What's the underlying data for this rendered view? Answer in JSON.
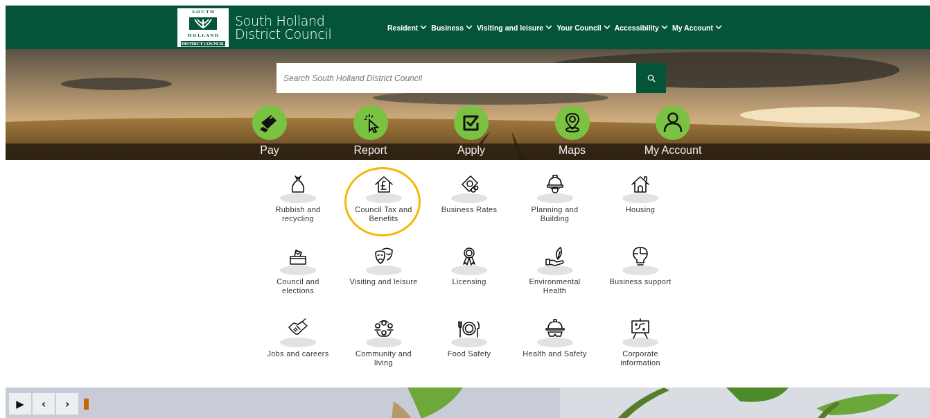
{
  "header": {
    "logo": {
      "top": "S O U T H",
      "middle": "H O L L A N D",
      "bottom": "DISTRICT COUNCIL"
    },
    "title": "South Holland District Council",
    "nav": [
      {
        "label": "Resident"
      },
      {
        "label": "Business"
      },
      {
        "label": "Visiting and leisure"
      },
      {
        "label": "Your Council"
      },
      {
        "label": "Accessibility"
      },
      {
        "label": "My Account"
      }
    ]
  },
  "search": {
    "placeholder": "Search South Holland District Council"
  },
  "quick_links": [
    {
      "label": "Pay"
    },
    {
      "label": "Report"
    },
    {
      "label": "Apply"
    },
    {
      "label": "Maps"
    },
    {
      "label": "My Account"
    }
  ],
  "tiles": [
    {
      "label": "Rubbish and recycling",
      "highlighted": false
    },
    {
      "label": "Council Tax and Benefits",
      "highlighted": true
    },
    {
      "label": "Business Rates",
      "highlighted": false
    },
    {
      "label": "Planning and Building",
      "highlighted": false
    },
    {
      "label": "Housing",
      "highlighted": false
    },
    {
      "label": "Council and elections",
      "highlighted": false
    },
    {
      "label": "Visiting and leisure",
      "highlighted": false
    },
    {
      "label": "Licensing",
      "highlighted": false
    },
    {
      "label": "Environmental Health",
      "highlighted": false
    },
    {
      "label": "Business support",
      "highlighted": false
    },
    {
      "label": "Jobs and careers",
      "highlighted": false
    },
    {
      "label": "Community and living",
      "highlighted": false
    },
    {
      "label": "Food Safety",
      "highlighted": false
    },
    {
      "label": "Health and Safety",
      "highlighted": false
    },
    {
      "label": "Corporate information",
      "highlighted": false
    }
  ],
  "slider": {
    "play": "▶",
    "previous": "‹",
    "next": "›",
    "level": 0.05
  }
}
